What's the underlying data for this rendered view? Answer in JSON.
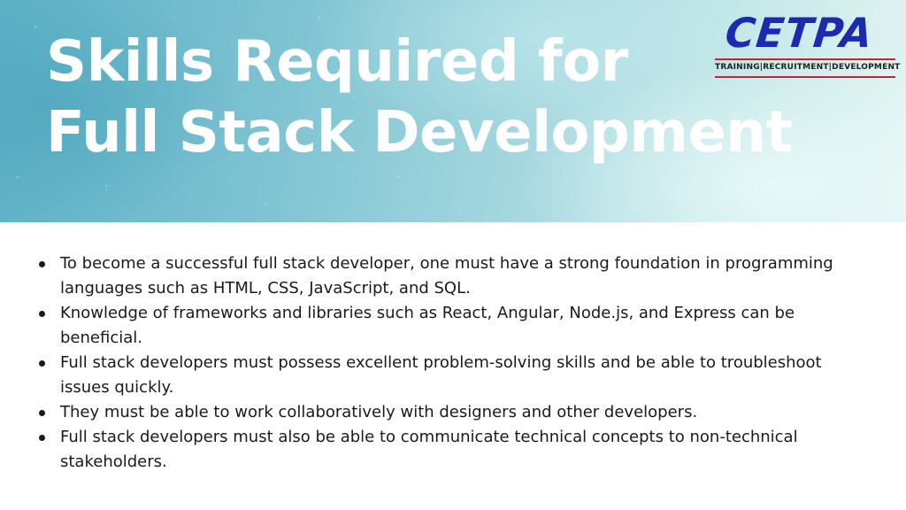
{
  "slide": {
    "title_lines": [
      "Skills Required for",
      "Full Stack Development"
    ],
    "logo": {
      "wordmark": "CETPA",
      "tagline": "TRAINING|RECRUITMENT|DEVELOPMENT",
      "colors": {
        "wordmark": "#1b2bb0",
        "rule": "#c0262a"
      }
    },
    "bullets": [
      "To become a successful full stack developer, one must have a strong foundation in programming languages such as HTML, CSS, JavaScript, and SQL.",
      "Knowledge of frameworks and libraries such as React, Angular, Node.js, and Express can be beneficial.",
      "Full stack developers must possess excellent problem-solving skills and be able to troubleshoot issues quickly.",
      "They must be able to work collaboratively with designers and other developers.",
      "Full stack developers must also be able to communicate technical concepts to non-technical stakeholders."
    ],
    "colors": {
      "banner_start": "#5fb1c6",
      "banner_end": "#e4f5f3",
      "title": "#ffffff",
      "body_text": "#1a1a1a"
    }
  }
}
